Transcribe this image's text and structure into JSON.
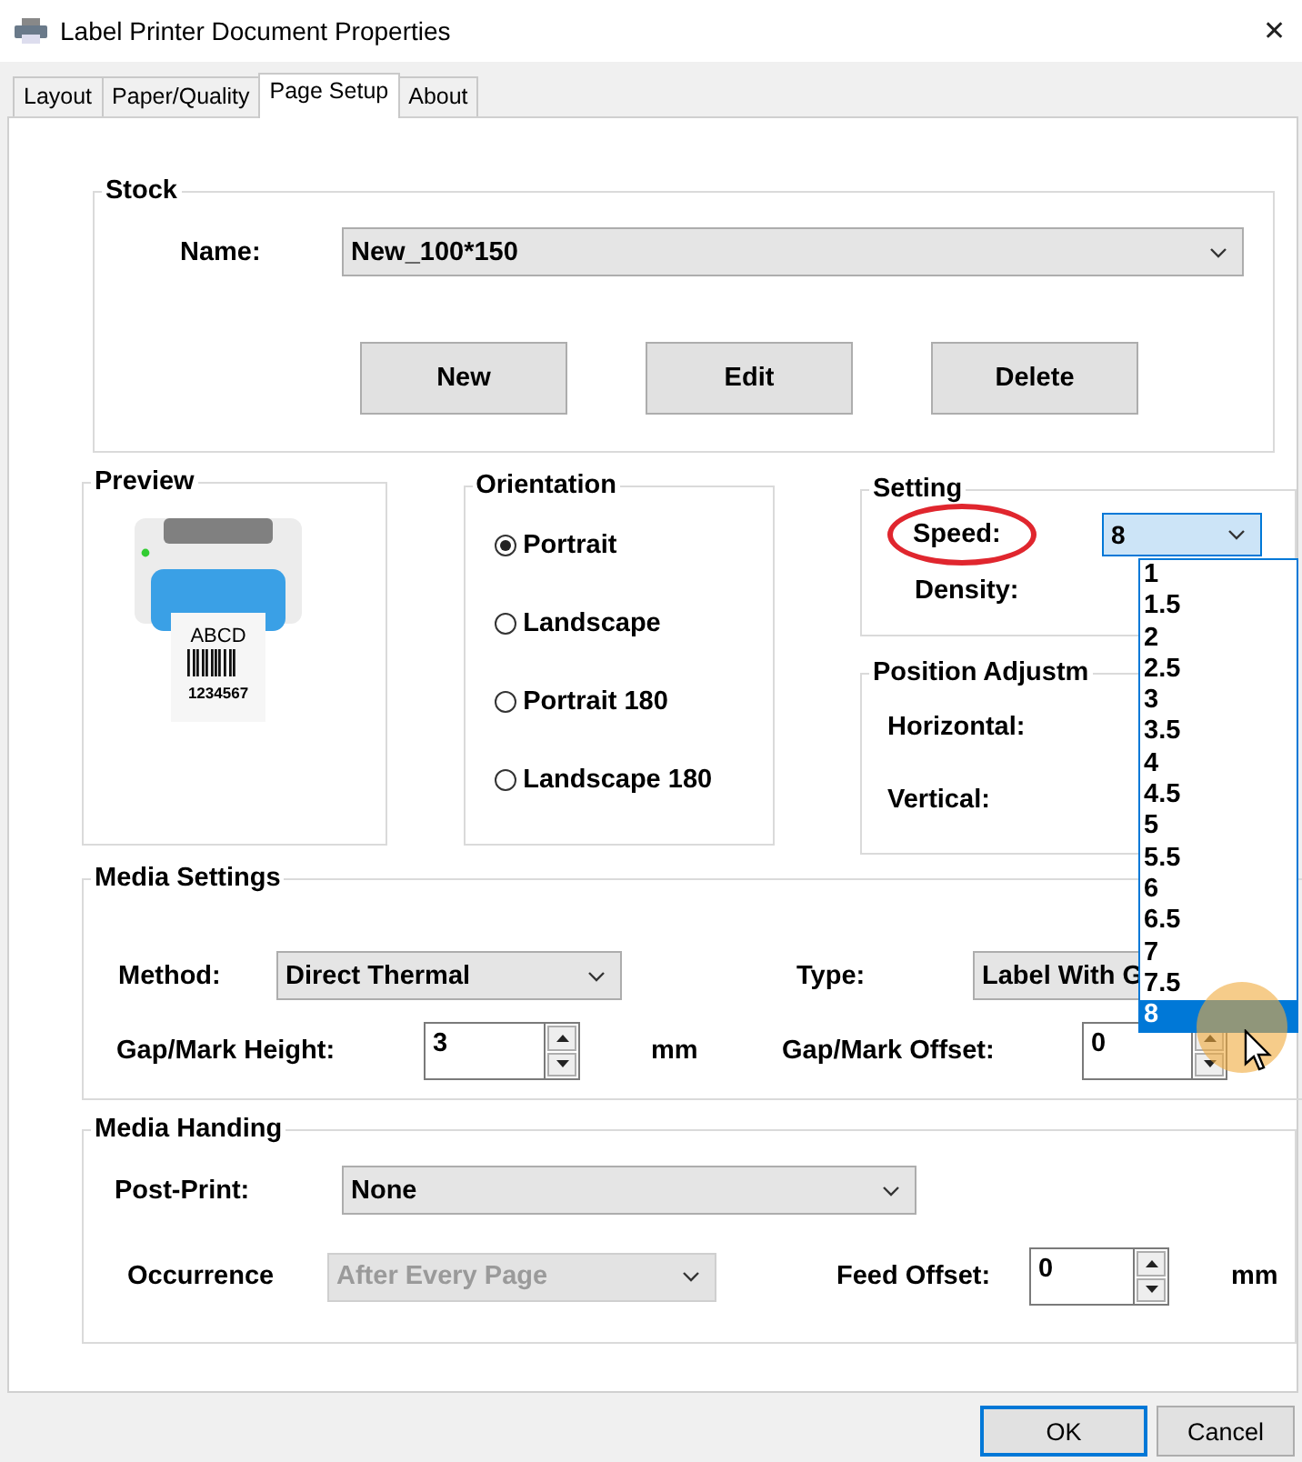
{
  "window": {
    "title": "Label Printer Document Properties",
    "close": "✕"
  },
  "tabs": [
    {
      "label": "Layout",
      "selected": false
    },
    {
      "label": "Paper/Quality",
      "selected": false
    },
    {
      "label": "Page Setup",
      "selected": true
    },
    {
      "label": "About",
      "selected": false
    }
  ],
  "stock": {
    "title": "Stock",
    "name_label": "Name:",
    "name_value": "New_100*150",
    "buttons": [
      "New",
      "Edit",
      "Delete"
    ]
  },
  "preview": {
    "title": "Preview",
    "label_text": "ABCD",
    "label_number": "1234567"
  },
  "orientation": {
    "title": "Orientation",
    "options": [
      {
        "label": "Portrait",
        "selected": true
      },
      {
        "label": "Landscape",
        "selected": false
      },
      {
        "label": "Portrait 180",
        "selected": false
      },
      {
        "label": "Landscape 180",
        "selected": false
      }
    ]
  },
  "setting": {
    "title": "Setting",
    "speed_label": "Speed:",
    "speed_highlighted": true,
    "speed_value": "8",
    "density_label": "Density:",
    "speed_list": {
      "expanded": true,
      "options": [
        {
          "label": "1",
          "selected": false
        },
        {
          "label": "1.5",
          "selected": false
        },
        {
          "label": "2",
          "selected": false
        },
        {
          "label": "2.5",
          "selected": false
        },
        {
          "label": "3",
          "selected": false
        },
        {
          "label": "3.5",
          "selected": false
        },
        {
          "label": "4",
          "selected": false
        },
        {
          "label": "4.5",
          "selected": false
        },
        {
          "label": "5",
          "selected": false
        },
        {
          "label": "5.5",
          "selected": false
        },
        {
          "label": "6",
          "selected": false
        },
        {
          "label": "6.5",
          "selected": false
        },
        {
          "label": "7",
          "selected": false
        },
        {
          "label": "7.5",
          "selected": false
        },
        {
          "label": "8",
          "selected": true
        }
      ]
    }
  },
  "position_adjustment": {
    "title": "Position Adjustm",
    "horizontal_label": "Horizontal:",
    "vertical_label": "Vertical:"
  },
  "media_settings": {
    "title": "Media Settings",
    "method_label": "Method:",
    "method_value": "Direct Thermal",
    "type_label": "Type:",
    "type_value": "Label With G",
    "gap_height_label": "Gap/Mark Height:",
    "gap_height_value": "3",
    "gap_height_unit": "mm",
    "gap_offset_label": "Gap/Mark Offset:",
    "gap_offset_value": "0"
  },
  "media_handing": {
    "title": "Media Handing",
    "post_print_label": "Post-Print:",
    "post_print_value": "None",
    "occurrence_label": "Occurrence",
    "occurrence_value": "After Every Page",
    "occurrence_disabled": true,
    "feed_offset_label": "Feed Offset:",
    "feed_offset_value": "0",
    "feed_offset_unit": "mm"
  },
  "buttons": [
    {
      "label": "OK",
      "default": true
    },
    {
      "label": "Cancel",
      "default": false
    }
  ]
}
